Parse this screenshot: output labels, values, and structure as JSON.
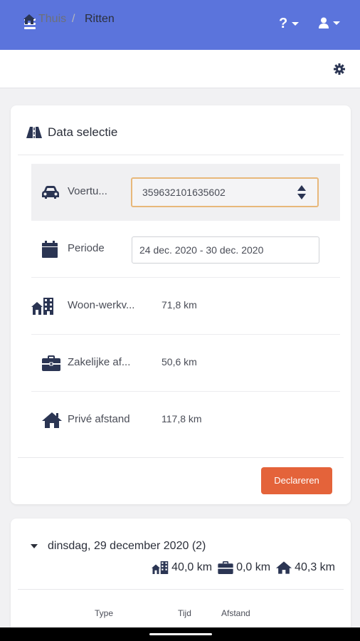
{
  "breadcrumb": {
    "home": "Thuis",
    "separator": "/",
    "current": "Ritten"
  },
  "topbar": {
    "help_label": "?"
  },
  "data_selection": {
    "title": "Data selectie",
    "vehicle": {
      "label": "Voertu...",
      "value": "359632101635602"
    },
    "period": {
      "label": "Periode",
      "value": "24 dec. 2020 - 30 dec. 2020"
    },
    "commute": {
      "label": "Woon-werkv...",
      "value": "71,8 km"
    },
    "business": {
      "label": "Zakelijke af...",
      "value": "50,6 km"
    },
    "private": {
      "label": "Privé afstand",
      "value": "117,8 km"
    },
    "declare_button": "Declareren"
  },
  "day_group": {
    "title": "dinsdag, 29 december 2020 (2)",
    "commute_km": "40,0 km",
    "business_km": "0,0 km",
    "private_km": "40,3 km",
    "columns": [
      "Type",
      "Tijd",
      "Afstand"
    ]
  },
  "colors": {
    "header": "#5b74dc",
    "accent": "#e4633a",
    "icon": "#2b3553"
  }
}
